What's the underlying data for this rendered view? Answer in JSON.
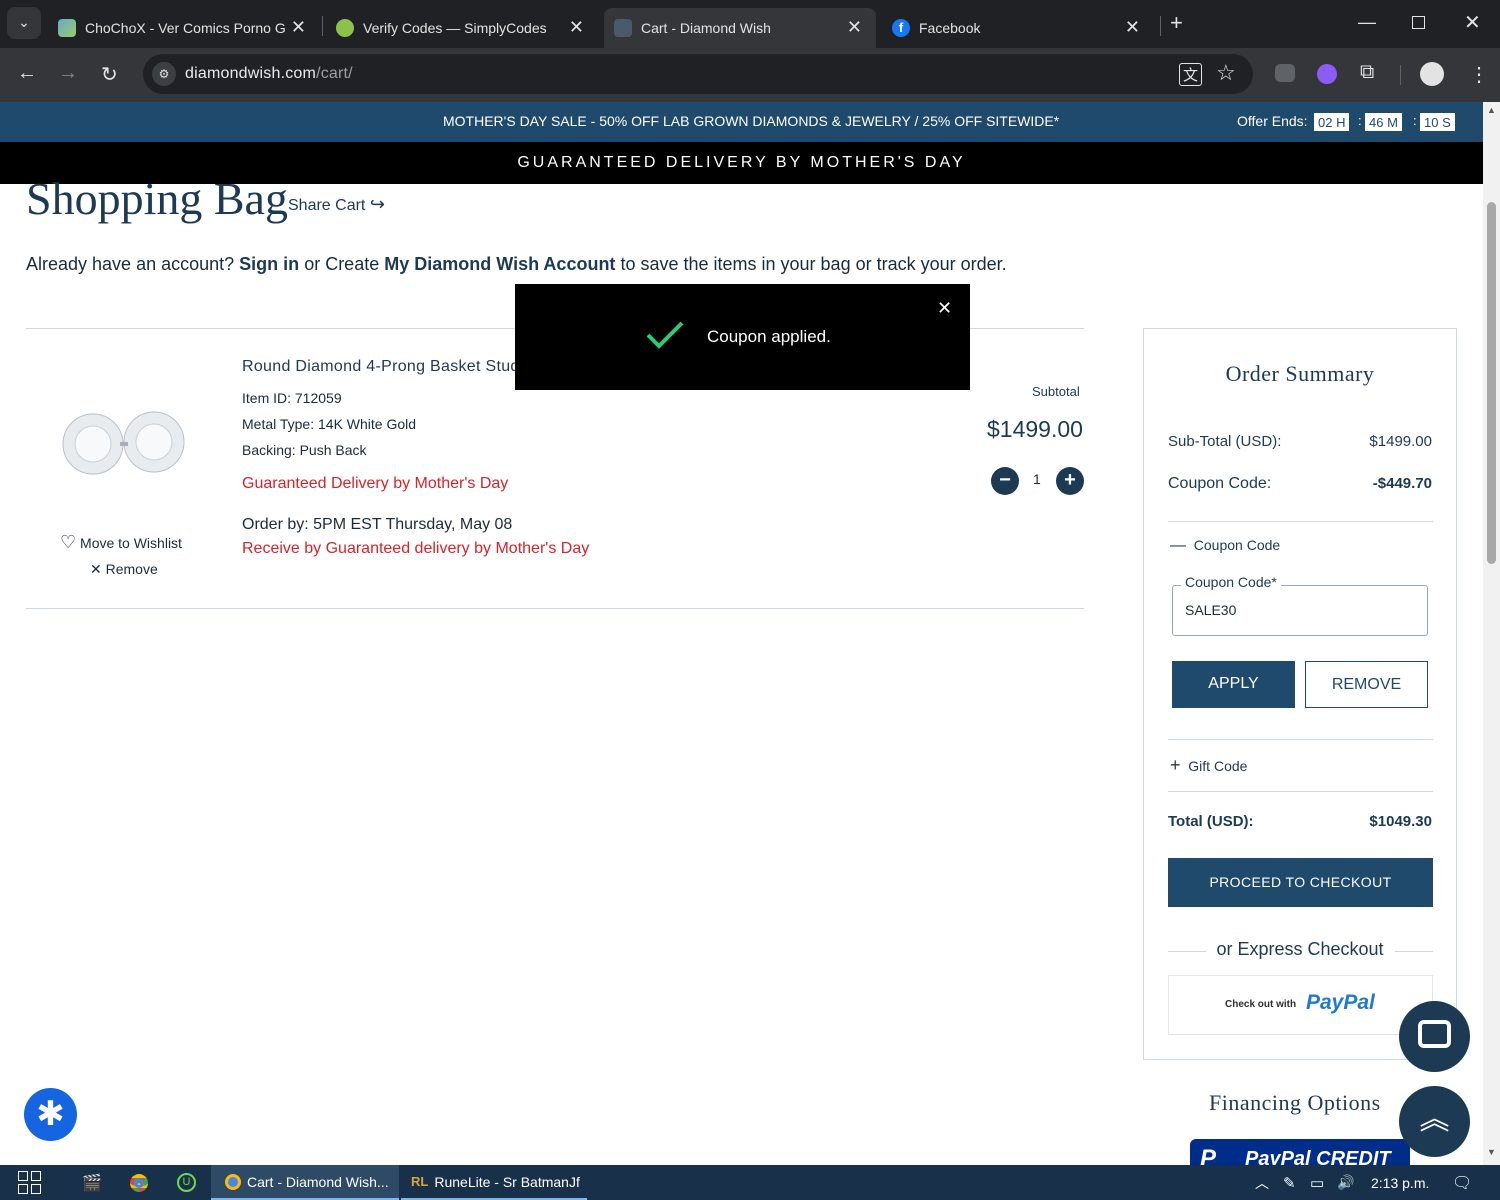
{
  "browser": {
    "tabs": [
      {
        "title": "ChoChoX - Ver Comics Porno G",
        "active": false
      },
      {
        "title": "Verify Codes — SimplyCodes",
        "active": false
      },
      {
        "title": "Cart - Diamond Wish",
        "active": true
      },
      {
        "title": "Facebook",
        "active": false
      }
    ],
    "url_domain": "diamondwish.com",
    "url_path": "/cart/"
  },
  "promo": {
    "message": "MOTHER'S DAY SALE - 50% OFF LAB GROWN DIAMONDS & JEWELRY / 25% OFF SITEWIDE*",
    "offer_label": "Offer Ends:",
    "hours": "02 H",
    "minutes": "46 M",
    "seconds": "10 S",
    "delivery_banner": "GUARANTEED DELIVERY BY MOTHER'S DAY"
  },
  "cart": {
    "title": "Shopping Bag",
    "share_label": "Share Cart",
    "account_prefix": "Already have an account?",
    "sign_in": "Sign in",
    "or_create": "or Create",
    "account_link": "My Diamond Wish Account",
    "account_suffix": "to save the items in your bag or track your order.",
    "item": {
      "name": "Round Diamond 4-Prong Basket Stud",
      "item_id": "Item ID: 712059",
      "metal": "Metal Type: 14K White Gold",
      "backing": "Backing: Push Back",
      "delivery": "Guaranteed Delivery by Mother's Day",
      "order_by": "Order by: 5PM EST Thursday, May 08",
      "receive_by": "Receive by Guaranteed delivery by Mother's Day",
      "subtotal_label": "Subtotal",
      "price": "$1499.00",
      "quantity": "1",
      "wishlist_label": "Move to Wishlist",
      "remove_label": "Remove"
    }
  },
  "toast": {
    "message": "Coupon applied."
  },
  "summary": {
    "title": "Order Summary",
    "subtotal_label": "Sub-Total (USD):",
    "subtotal_value": "$1499.00",
    "coupon_label": "Coupon Code:",
    "coupon_value": "-$449.70",
    "coupon_section": "Coupon Code",
    "coupon_field_label": "Coupon Code*",
    "coupon_field_value": "SALE30",
    "apply": "APPLY",
    "remove": "REMOVE",
    "gift_code": "Gift Code",
    "total_label": "Total (USD):",
    "total_value": "$1049.30",
    "checkout": "PROCEED TO CHECKOUT",
    "express": "or Express Checkout",
    "paypal_prefix": "Check out with",
    "paypal": "PayPal",
    "financing": "Financing Options",
    "paypal_credit": "PayPal CREDIT"
  },
  "taskbar": {
    "items": [
      "Cart - Diamond Wish...",
      "RuneLite - Sr BatmanJf"
    ],
    "time": "2:13 p.m."
  },
  "colors": {
    "navy": "#1f4a6b",
    "accent_red": "#d8232a",
    "success_green": "#2ecc71"
  }
}
